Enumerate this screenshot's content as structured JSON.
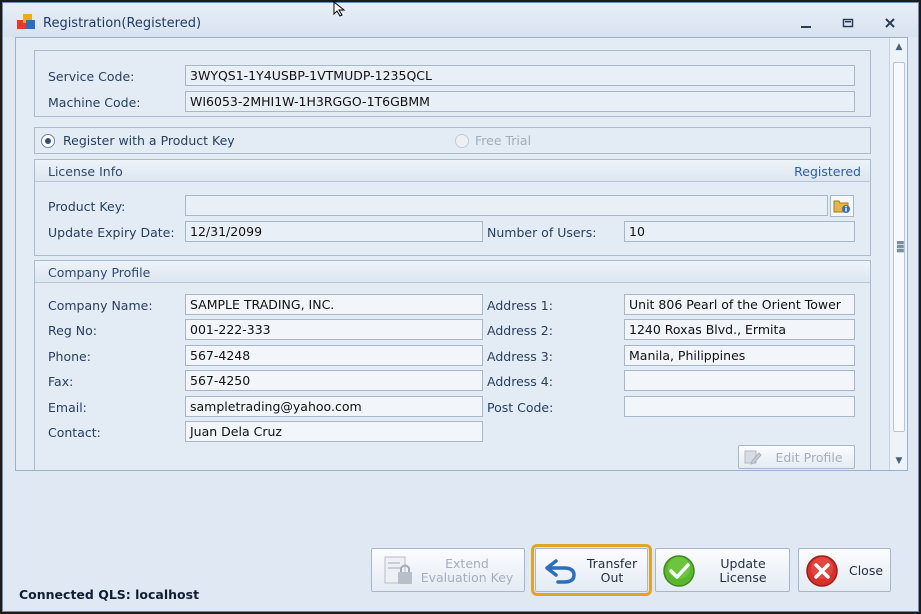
{
  "window": {
    "title": "Registration(Registered)"
  },
  "service": {
    "service_code_label": "Service Code:",
    "service_code": "3WYQS1-1Y4USBP-1VTMUDP-1235QCL",
    "machine_code_label": "Machine Code:",
    "machine_code": "WI6053-2MHI1W-1H3RGGO-1T6GBMM"
  },
  "registration": {
    "option_product_key": "Register with a Product Key",
    "option_free_trial": "Free Trial",
    "selected": "Register with a Product Key"
  },
  "license_info": {
    "title": "License Info",
    "status": "Registered",
    "product_key_label": "Product Key:",
    "product_key": "",
    "update_expiry_label": "Update Expiry Date:",
    "update_expiry": "12/31/2099",
    "users_label": "Number of Users:",
    "users": "10"
  },
  "company": {
    "title": "Company Profile",
    "name_label": "Company Name:",
    "name": "SAMPLE TRADING, INC.",
    "reg_label": "Reg No:",
    "reg": "001-222-333",
    "phone_label": "Phone:",
    "phone": "567-4248",
    "fax_label": "Fax:",
    "fax": "567-4250",
    "email_label": "Email:",
    "email": "sampletrading@yahoo.com",
    "contact_label": "Contact:",
    "contact": "Juan Dela Cruz",
    "address1_label": "Address 1:",
    "address1": "Unit 806 Pearl of the Orient Tower",
    "address2_label": "Address 2:",
    "address2": "1240 Roxas Blvd., Ermita",
    "address3_label": "Address 3:",
    "address3": "Manila, Philippines",
    "address4_label": "Address 4:",
    "address4": "",
    "postcode_label": "Post Code:",
    "postcode": "",
    "edit_profile": "Edit Profile"
  },
  "buttons": {
    "extend_line1": "Extend",
    "extend_line2": "Evaluation Key",
    "transfer_line1": "Transfer",
    "transfer_line2": "Out",
    "update_line1": "Update",
    "update_line2": "License",
    "close": "Close"
  },
  "status": {
    "connection": "Connected QLS: localhost"
  },
  "colors": {
    "highlight": "#e0a527",
    "registered": "#2860a8",
    "update_icon": "#5ab82f",
    "close_icon": "#d6312b",
    "transfer_icon": "#2d6fb8"
  },
  "icons": [
    "app-icon",
    "minimize-icon",
    "restore-icon",
    "close-window-icon",
    "browse-key-icon",
    "edit-profile-icon",
    "extend-lock-icon",
    "transfer-arrow-icon",
    "update-check-icon",
    "close-x-icon"
  ]
}
